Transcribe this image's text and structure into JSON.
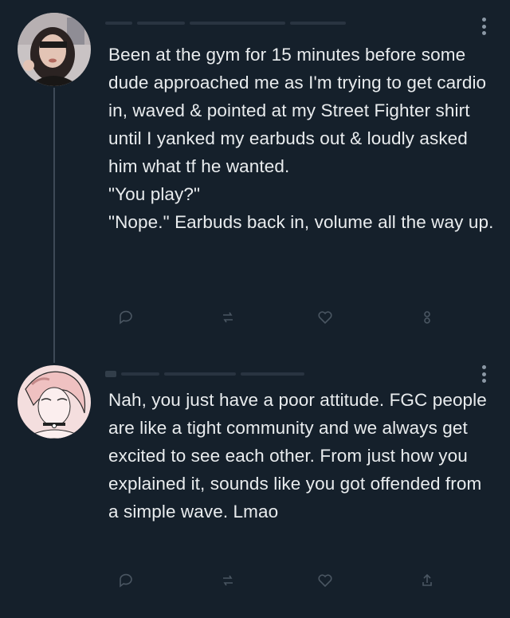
{
  "colors": {
    "background": "#15202b",
    "text": "#e7e9ea",
    "muted": "#8b98a5"
  },
  "tweets": [
    {
      "text": "Been at the gym for 15 minutes before some dude approached me as I'm trying to get cardio in, waved & pointed at my Street Fighter shirt until I yanked my earbuds out & loudly asked him what tf he wanted.\n\"You play?\"\n\"Nope.\" Earbuds back in, volume all the way up."
    },
    {
      "text": "Nah, you just have a poor attitude. FGC people are like a tight community and we always get excited to see each other. From just how you explained it, sounds like you got offended from a simple wave. Lmao"
    }
  ],
  "icons": {
    "more": "more-icon",
    "reply": "reply-icon",
    "retweet": "retweet-icon",
    "like": "like-icon",
    "share": "share-icon"
  }
}
